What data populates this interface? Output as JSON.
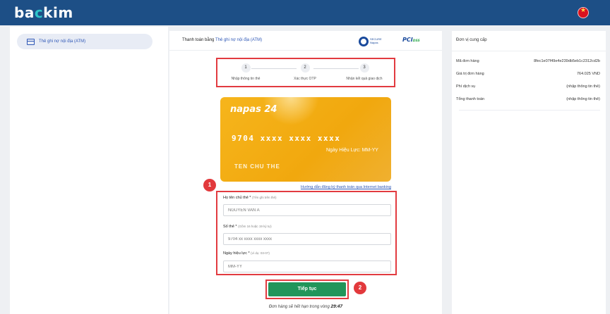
{
  "header": {
    "logo_left": "ba",
    "logo_dot": "c",
    "logo_right": "kim",
    "flag_icon": "vietnam-flag-icon"
  },
  "sidebar": {
    "items": [
      {
        "label": "Thẻ ghi nợ nội địa (ATM)",
        "icon": "atm-card-icon"
      }
    ]
  },
  "main": {
    "title_prefix": "Thanh toán bằng",
    "title_method": "Thẻ ghi nợ nội địa (ATM)",
    "steps": [
      {
        "num": "1",
        "label": "Nhập thông tin thẻ"
      },
      {
        "num": "2",
        "label": "Xác thực OTP"
      },
      {
        "num": "3",
        "label": "Nhận kết quả giao dịch"
      }
    ],
    "card": {
      "brand": "napas 24",
      "number": "9704 xxxx xxxx xxxx",
      "expiry": "Ngày Hiệu Lực: MM-YY",
      "holder": "TEN CHU THE"
    },
    "guide_link": "Hướng dẫn đăng ký thanh toán qua Internet banking",
    "fields": [
      {
        "label": "Họ tên chủ thẻ *",
        "hint": "(Tên ghi trên thẻ)",
        "placeholder": "NGUYEN VAN A"
      },
      {
        "label": "Số thẻ *",
        "hint": "(Gồm 16 hoặc 19 ký tự)",
        "placeholder": "9704 xx xxxx xxxx xxxx"
      },
      {
        "label": "Ngày hiệu lực *",
        "hint": "(ví dụ: 03-07)",
        "placeholder": "MM-YY"
      }
    ],
    "submit_label": "Tiếp tục",
    "timer_text": "Đơn hàng sẽ hết hạn trong vòng",
    "timer_value": "29:47",
    "markers": [
      "1",
      "2"
    ]
  },
  "summary": {
    "provider_label": "Đơn vị cung cấp",
    "rows": [
      {
        "key": "Mã đơn hàng",
        "value": "8fec1e07f49e4e239db5eb1c2312cd2b"
      },
      {
        "key": "Giá trị đơn hàng",
        "value": "764.025 VND"
      },
      {
        "key": "Phí dịch vụ",
        "value": "(nhập thông tin thẻ)"
      },
      {
        "key": "Tổng thanh toán",
        "value": "(nhập thông tin thẻ)"
      }
    ]
  },
  "colors": {
    "header": "#1d4f86",
    "highlight": "#e23b40",
    "button": "#21955a",
    "card": "#f6b51c"
  }
}
